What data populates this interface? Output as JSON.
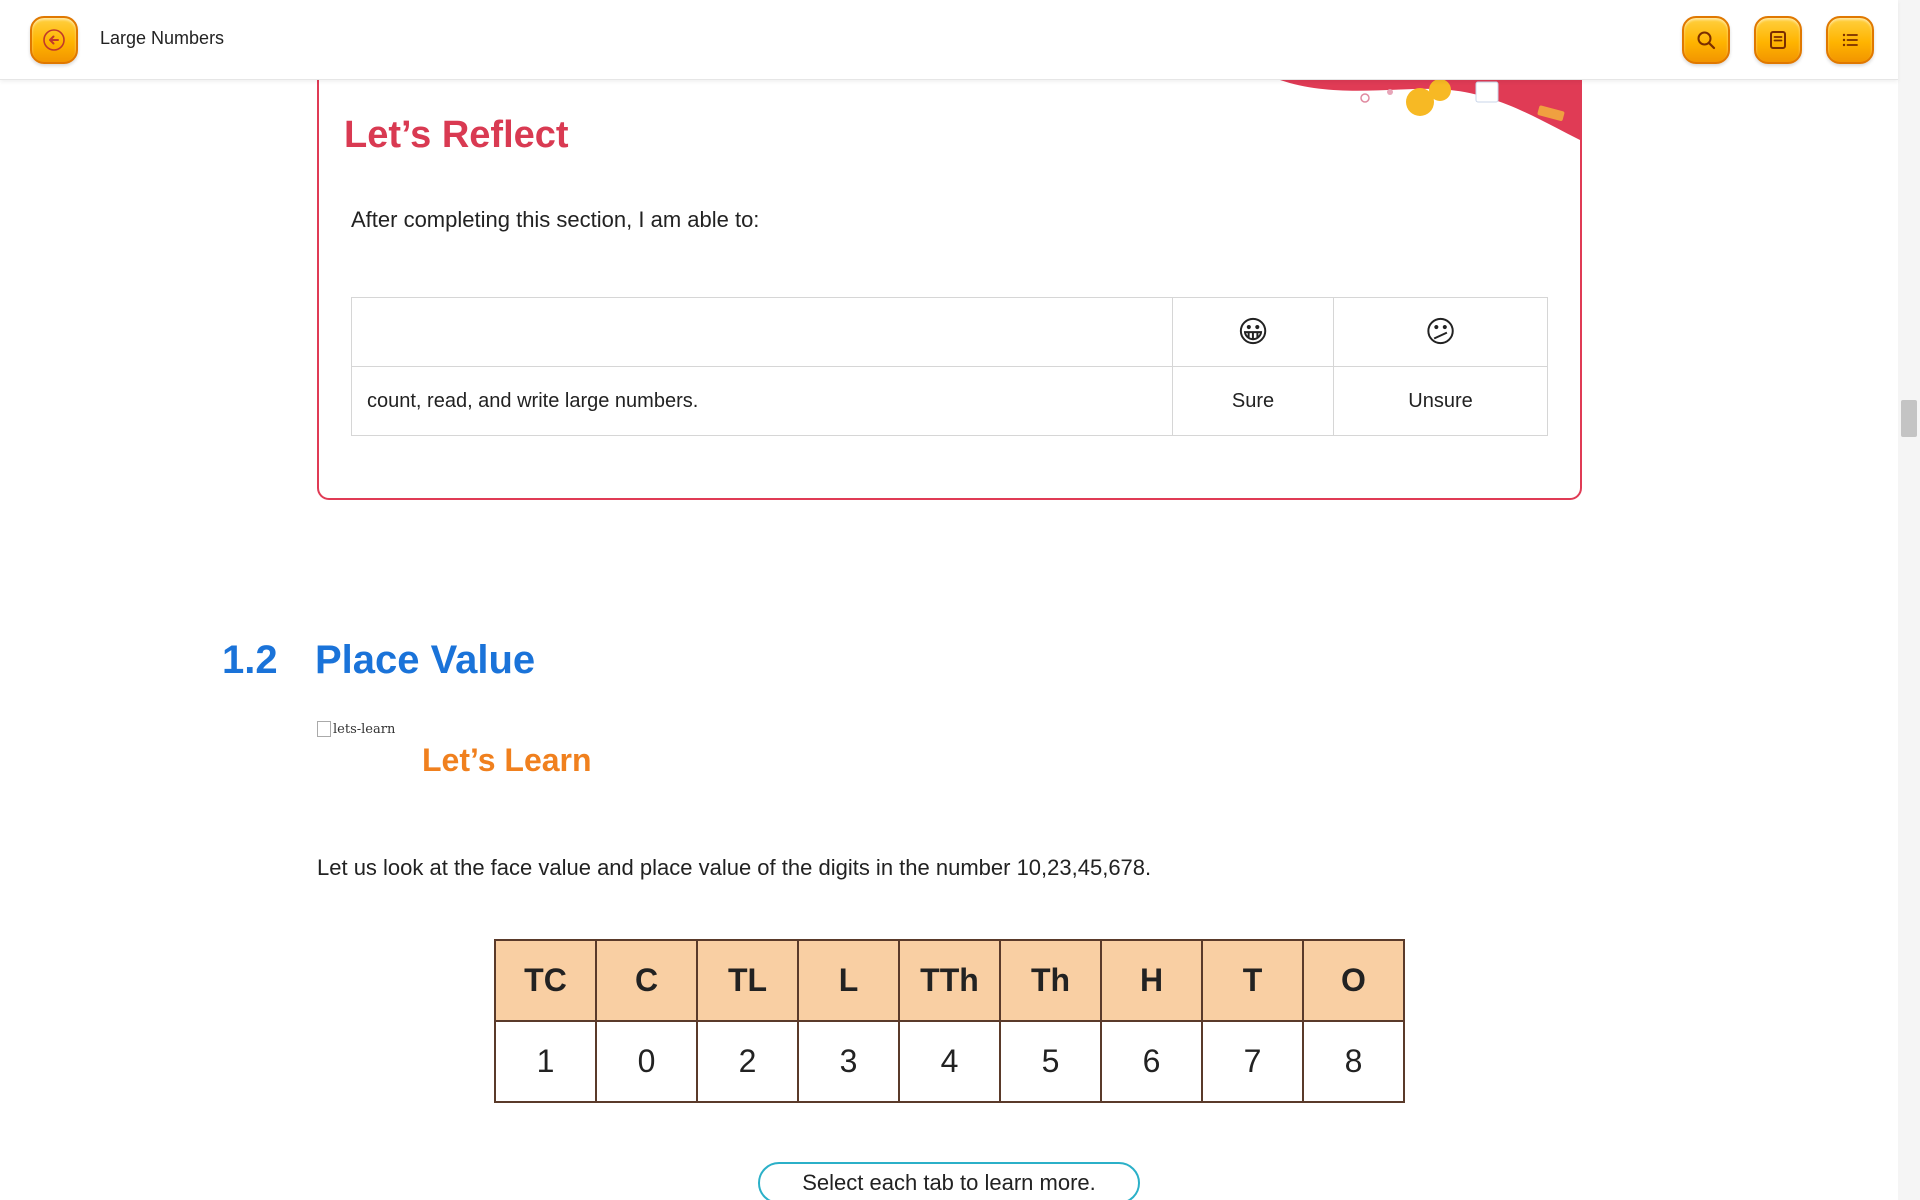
{
  "header": {
    "title": "Large Numbers",
    "back_icon": "arrow-left-icon",
    "search_icon": "search-icon",
    "notes_icon": "notes-icon",
    "toc_icon": "list-icon"
  },
  "colors": {
    "button_orange": "#ffb400",
    "reflect_red": "#d93a52",
    "section_blue": "#1a73d9",
    "learn_orange": "#f0801e",
    "table_header_peach": "#f9cfa3"
  },
  "reflect": {
    "heading": "Let’s Reflect",
    "intro": "After completing this section, I am able to:",
    "emoji_sure": "😀",
    "emoji_unsure": "😕",
    "row_statement": "count, read, and write large numbers.",
    "sure_label": "Sure",
    "unsure_label": "Unsure"
  },
  "section": {
    "number": "1.2",
    "title": "Place Value"
  },
  "learn": {
    "image_alt": "lets-learn",
    "heading": "Let’s Learn",
    "intro": "Let us look at the face value and place value of the digits in the number 10,23,45,678."
  },
  "place_value_table": {
    "headers": [
      "TC",
      "C",
      "TL",
      "L",
      "TTh",
      "Th",
      "H",
      "T",
      "O"
    ],
    "digits": [
      "1",
      "0",
      "2",
      "3",
      "4",
      "5",
      "6",
      "7",
      "8"
    ]
  },
  "tabs_hint": "Select each tab to learn more."
}
